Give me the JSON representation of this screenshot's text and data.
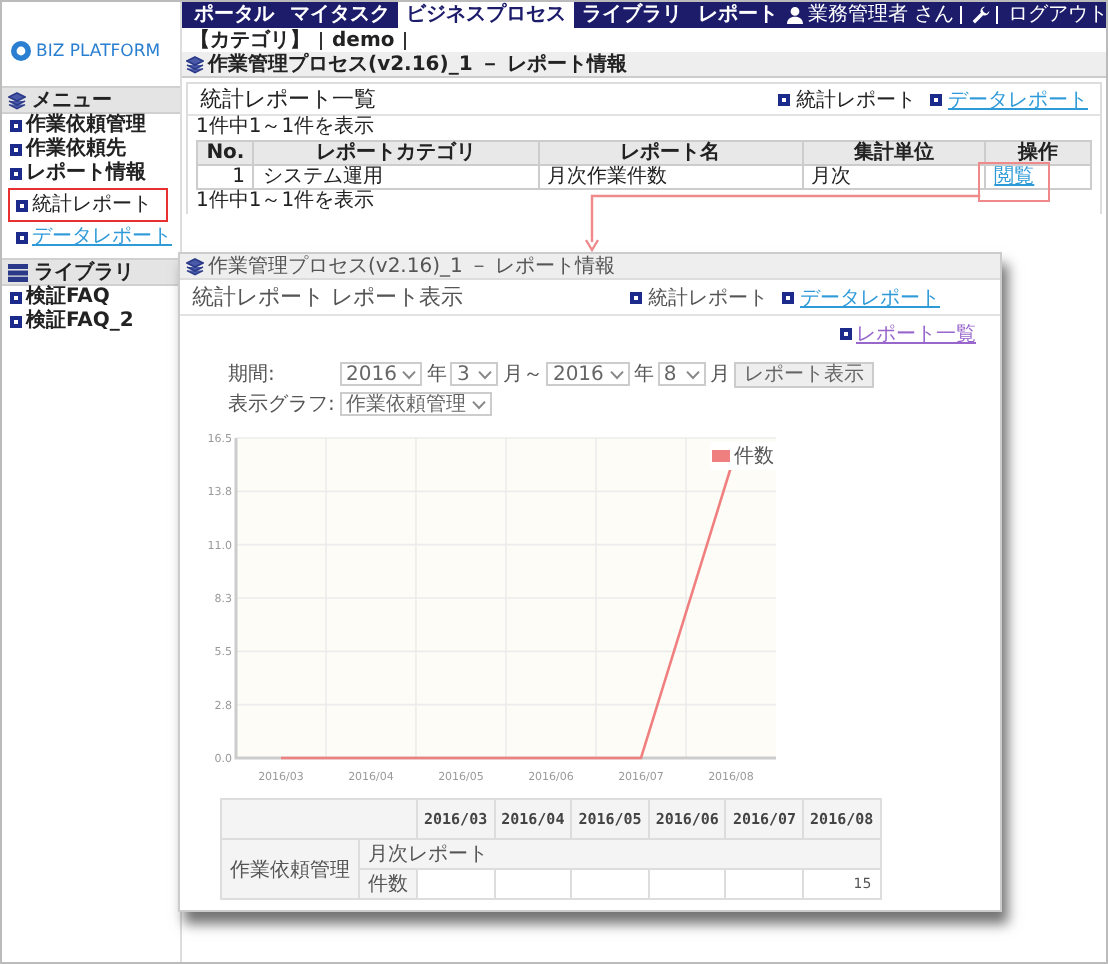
{
  "top_nav": {
    "items": [
      {
        "label": "ポータル",
        "selected": false
      },
      {
        "label": "マイタスク",
        "selected": false
      },
      {
        "label": "ビジネスプロセス",
        "selected": true
      },
      {
        "label": "ライブラリ",
        "selected": false
      },
      {
        "label": "レポート",
        "selected": false
      }
    ],
    "user": "業務管理者 さん",
    "logout": "ログアウト"
  },
  "logo": {
    "text": "BIZ PLATFORM"
  },
  "breadcrumb": [
    "【カテゴリ】",
    "demo"
  ],
  "process_title": "作業管理プロセス(v2.16)_1 － レポート情報",
  "sidebar": {
    "sections": [
      {
        "title": "メニュー",
        "kind": "menu",
        "items": [
          {
            "label": "作業依頼管理"
          },
          {
            "label": "作業依頼先"
          },
          {
            "label": "レポート情報",
            "children": [
              {
                "label": "統計レポート",
                "link": false,
                "highlighted": true
              },
              {
                "label": "データレポート",
                "link": true,
                "highlighted": false
              }
            ]
          }
        ]
      },
      {
        "title": "ライブラリ",
        "kind": "library",
        "items": [
          {
            "label": "検証FAQ"
          },
          {
            "label": "検証FAQ_2"
          }
        ]
      }
    ]
  },
  "main": {
    "heading": "統計レポート一覧",
    "links": [
      {
        "label": "統計レポート",
        "link": false
      },
      {
        "label": "データレポート",
        "link": true
      }
    ],
    "count_top": "1件中1～1件を表示",
    "table": {
      "columns": [
        "No.",
        "レポートカテゴリ",
        "レポート名",
        "集計単位",
        "操作"
      ],
      "rows": [
        {
          "cells": [
            "1",
            "システム運用",
            "月次作業件数",
            "月次"
          ],
          "action": {
            "label": "閲覧",
            "highlighted": true
          }
        }
      ]
    },
    "count_bottom": "1件中1～1件を表示"
  },
  "report_window": {
    "title": "作業管理プロセス(v2.16)_1 － レポート情報",
    "heading": "統計レポート レポート表示",
    "links": [
      {
        "label": "統計レポート",
        "link": false
      },
      {
        "label": "データレポート",
        "link": true
      }
    ],
    "back_link": "レポート一覧",
    "period": {
      "label": "期間:",
      "fields": [
        {
          "kind": "select",
          "text": "2016"
        },
        {
          "kind": "unit",
          "text": "年"
        },
        {
          "kind": "select",
          "text": "3"
        },
        {
          "kind": "unit",
          "text": "月～"
        },
        {
          "kind": "select",
          "text": "2016"
        },
        {
          "kind": "unit",
          "text": "年"
        },
        {
          "kind": "select",
          "text": "8"
        },
        {
          "kind": "unit",
          "text": "月"
        },
        {
          "kind": "button",
          "text": "レポート表示"
        }
      ]
    },
    "graph": {
      "label": "表示グラフ:",
      "value": "作業依頼管理"
    },
    "chart_data": {
      "type": "line",
      "categories": [
        "2016/03",
        "2016/04",
        "2016/05",
        "2016/06",
        "2016/07",
        "2016/08"
      ],
      "series": [
        {
          "name": "件数",
          "color": "#f08080",
          "values": [
            0,
            0,
            0,
            0,
            0,
            15
          ]
        }
      ],
      "ylim": [
        0,
        16.5
      ],
      "grid": true,
      "yticks": [
        {
          "value": 0,
          "label": "0.0"
        },
        {
          "value": 2.75,
          "label": "2.8"
        },
        {
          "value": 5.5,
          "label": "5.5"
        },
        {
          "value": 8.25,
          "label": "8.3"
        },
        {
          "value": 11,
          "label": "11.0"
        },
        {
          "value": 13.75,
          "label": "13.8"
        },
        {
          "value": 16.5,
          "label": "16.5"
        }
      ]
    },
    "table": {
      "columns": [
        "2016/03",
        "2016/04",
        "2016/05",
        "2016/06",
        "2016/07",
        "2016/08"
      ],
      "group": "作業依頼管理",
      "subheading": "月次レポート",
      "rows": [
        {
          "label": "件数",
          "cells": [
            {},
            {},
            {},
            {},
            {},
            {
              "text": "15"
            }
          ]
        }
      ]
    }
  }
}
